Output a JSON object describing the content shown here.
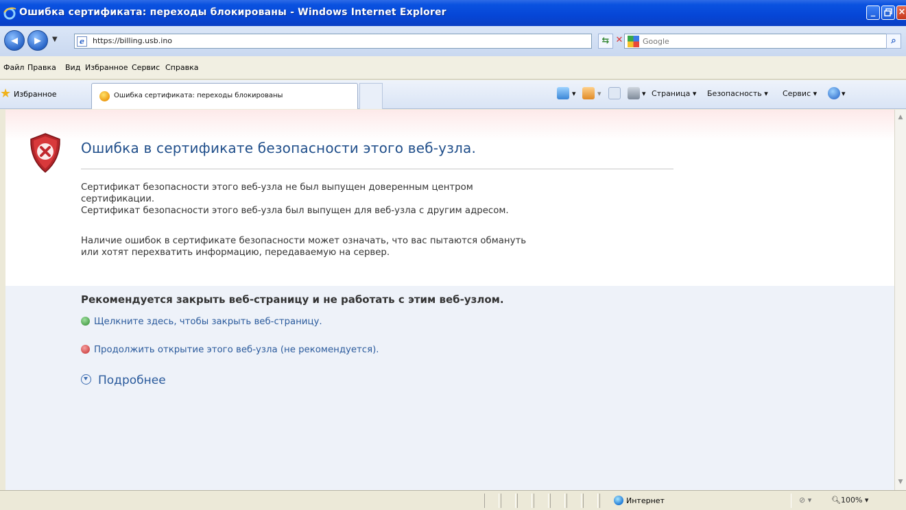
{
  "window": {
    "title": "Ошибка сертификата: переходы блокированы - Windows Internet Explorer",
    "min_label": "_",
    "max_label": "▫",
    "close_label": "×"
  },
  "address_bar": {
    "url": "https://billing.usb.ino",
    "search_placeholder": "Google"
  },
  "menu": [
    "Файл",
    "Правка",
    "Вид",
    "Избранное",
    "Сервис",
    "Справка"
  ],
  "favorites": {
    "label": "Избранное"
  },
  "tab": {
    "label": "Ошибка сертификата: переходы блокированы"
  },
  "toolbar": {
    "page_label": "Страница ▾",
    "security_label": "Безопасность ▾",
    "service_label": "Сервис ▾"
  },
  "content": {
    "heading": "Ошибка в сертификате безопасности этого веб-узла.",
    "para1_line1": "Сертификат безопасности этого веб-узла не был выпущен доверенным центром",
    "para1_line2": "сертификации.",
    "para1_line3": "Сертификат безопасности этого веб-узла был выпущен для веб-узла с другим адресом.",
    "para2_line1": "Наличие ошибок в сертификате безопасности может означать, что вас пытаются обмануть",
    "para2_line2": "или хотят перехватить информацию, передаваемую на сервер.",
    "recommend": "Рекомендуется закрыть веб-страницу и не работать с этим веб-узлом.",
    "close_link": "Щелкните здесь, чтобы закрыть веб-страницу.",
    "continue_link": "Продолжить открытие этого веб-узла (не рекомендуется).",
    "more": "Подробнее"
  },
  "status": {
    "zone": "Интернет",
    "zoom": "100%"
  },
  "colors": {
    "titlebar": "#0646d6",
    "heading": "#1f4e8a",
    "link": "#2a5a9c",
    "ok_green": "#3a9c3a",
    "error_red": "#c93a3a"
  }
}
